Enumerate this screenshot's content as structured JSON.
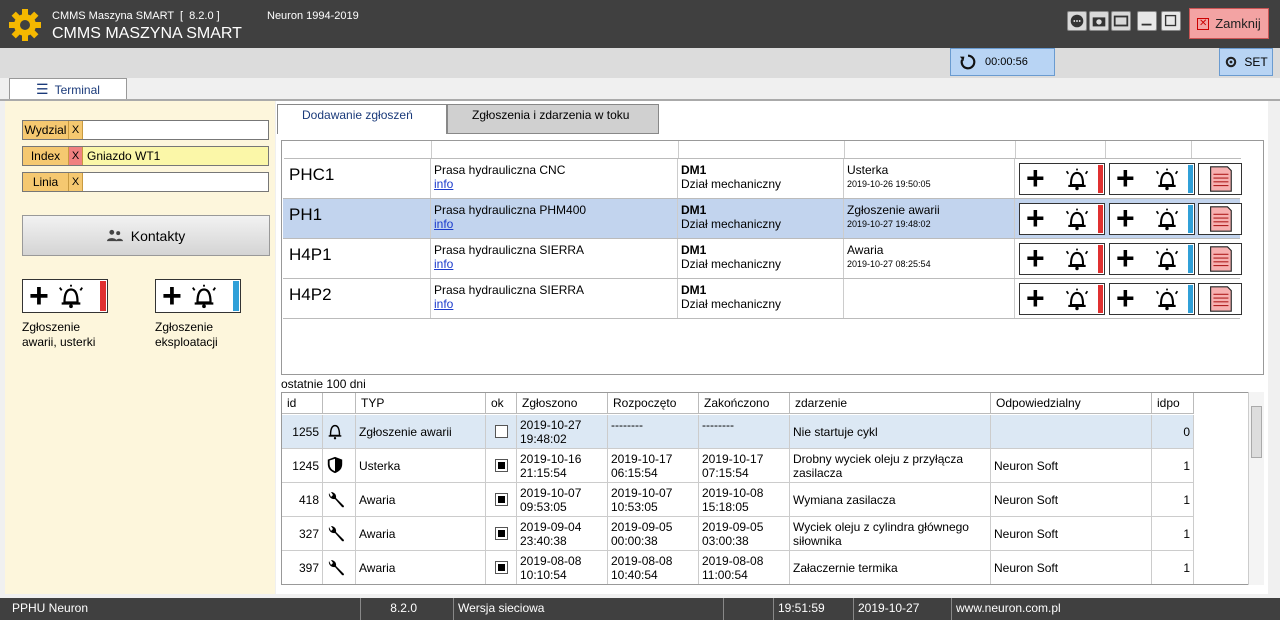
{
  "titlebar": {
    "app_small": "CMMS Maszyna SMART  [  8.2.0 ]",
    "app_big": "CMMS MASZYNA SMART",
    "neuron": "Neuron 1994-2019",
    "close_label": "Zamknij"
  },
  "toolbar": {
    "timer": "00:00:56",
    "set_label": "SET"
  },
  "terminal_tab": "Terminal",
  "filters": [
    {
      "label": "Wydzial",
      "x": "X",
      "value": ""
    },
    {
      "label": "Index",
      "x": "X",
      "value": "Gniazdo WT1"
    },
    {
      "label": "Linia",
      "x": "X",
      "value": ""
    }
  ],
  "kontakty": "Kontakty",
  "left_buttons": [
    {
      "line1": "Zgłoszenie",
      "line2": "awarii, usterki",
      "bar": "#e03030"
    },
    {
      "line1": "Zgłoszenie",
      "line2": "eksploatacji",
      "bar": "#30a0d8"
    }
  ],
  "tabs": {
    "add": "Dodawanie zgłoszeń",
    "progress": "Zgłoszenia i zdarzenia w toku"
  },
  "machines": [
    {
      "code": "PHC1",
      "name": "Prasa hydrauliczna CNC",
      "link": "info",
      "dept_code": "DM1",
      "dept": "Dział mechaniczny",
      "status": "Usterka",
      "date": "2019-10-26 19:50:05"
    },
    {
      "code": "PH1",
      "name": "Prasa hydrauliczna PHM400",
      "link": "info",
      "dept_code": "DM1",
      "dept": "Dział mechaniczny",
      "status": "Zgłoszenie awarii",
      "date": "2019-10-27 19:48:02"
    },
    {
      "code": "H4P1",
      "name": "Prasa hydrauliczna SIERRA",
      "link": "info",
      "dept_code": "DM1",
      "dept": "Dział mechaniczny",
      "status": "Awaria",
      "date": "2019-10-27 08:25:54"
    },
    {
      "code": "H4P2",
      "name": "Prasa hydrauliczna SIERRA",
      "link": "info",
      "dept_code": "DM1",
      "dept": "Dział mechaniczny",
      "status": "",
      "date": ""
    }
  ],
  "last_days": "ostatnie 100 dni",
  "events_headers": {
    "id": "id",
    "typ": "TYP",
    "ok": "ok",
    "zgloszono": "Zgłoszono",
    "rozpoczeto": "Rozpoczęto",
    "zakonczono": "Zakończono",
    "zdarzenie": "zdarzenie",
    "odpowiedzialny": "Odpowiedzialny",
    "idpo": "idpo"
  },
  "events": [
    {
      "id": "1255",
      "icon": "bell-icon",
      "typ": "Zgłoszenie awarii",
      "ok": false,
      "zgl1": "2019-10-27",
      "zgl2": "19:48:02",
      "roz1": "--------",
      "roz2": "",
      "zak1": "--------",
      "zak2": "",
      "zdarzenie": "Nie startuje cykl",
      "odp": "",
      "idpo": "0"
    },
    {
      "id": "1245",
      "icon": "shield-icon",
      "typ": "Usterka",
      "ok": true,
      "zgl1": "2019-10-16",
      "zgl2": "21:15:54",
      "roz1": "2019-10-17",
      "roz2": "06:15:54",
      "zak1": "2019-10-17",
      "zak2": "07:15:54",
      "zdarzenie": "Drobny wyciek oleju z przyłącza zasilacza",
      "odp": "Neuron Soft",
      "idpo": "1"
    },
    {
      "id": "418",
      "icon": "wrench-icon",
      "typ": "Awaria",
      "ok": true,
      "zgl1": "2019-10-07",
      "zgl2": "09:53:05",
      "roz1": "2019-10-07",
      "roz2": "10:53:05",
      "zak1": "2019-10-08",
      "zak2": "15:18:05",
      "zdarzenie": "Wymiana zasilacza",
      "odp": "Neuron Soft",
      "idpo": "1"
    },
    {
      "id": "327",
      "icon": "wrench-icon",
      "typ": "Awaria",
      "ok": true,
      "zgl1": "2019-09-04",
      "zgl2": "23:40:38",
      "roz1": "2019-09-05",
      "roz2": "00:00:38",
      "zak1": "2019-09-05",
      "zak2": "03:00:38",
      "zdarzenie": "Wyciek oleju z cylindra głównego siłownika",
      "odp": "Neuron Soft",
      "idpo": "1"
    },
    {
      "id": "397",
      "icon": "wrench-icon",
      "typ": "Awaria",
      "ok": true,
      "zgl1": "2019-08-08",
      "zgl2": "10:10:54",
      "roz1": "2019-08-08",
      "roz2": "10:40:54",
      "zak1": "2019-08-08",
      "zak2": "11:00:54",
      "zdarzenie": "Załaczernie termika",
      "odp": "Neuron Soft",
      "idpo": "1"
    }
  ],
  "statusbar": {
    "company": "PPHU Neuron",
    "version": "8.2.0",
    "mode": "Wersja sieciowa",
    "time": "19:51:59",
    "date": "2019-10-27",
    "url": "www.neuron.com.pl"
  }
}
